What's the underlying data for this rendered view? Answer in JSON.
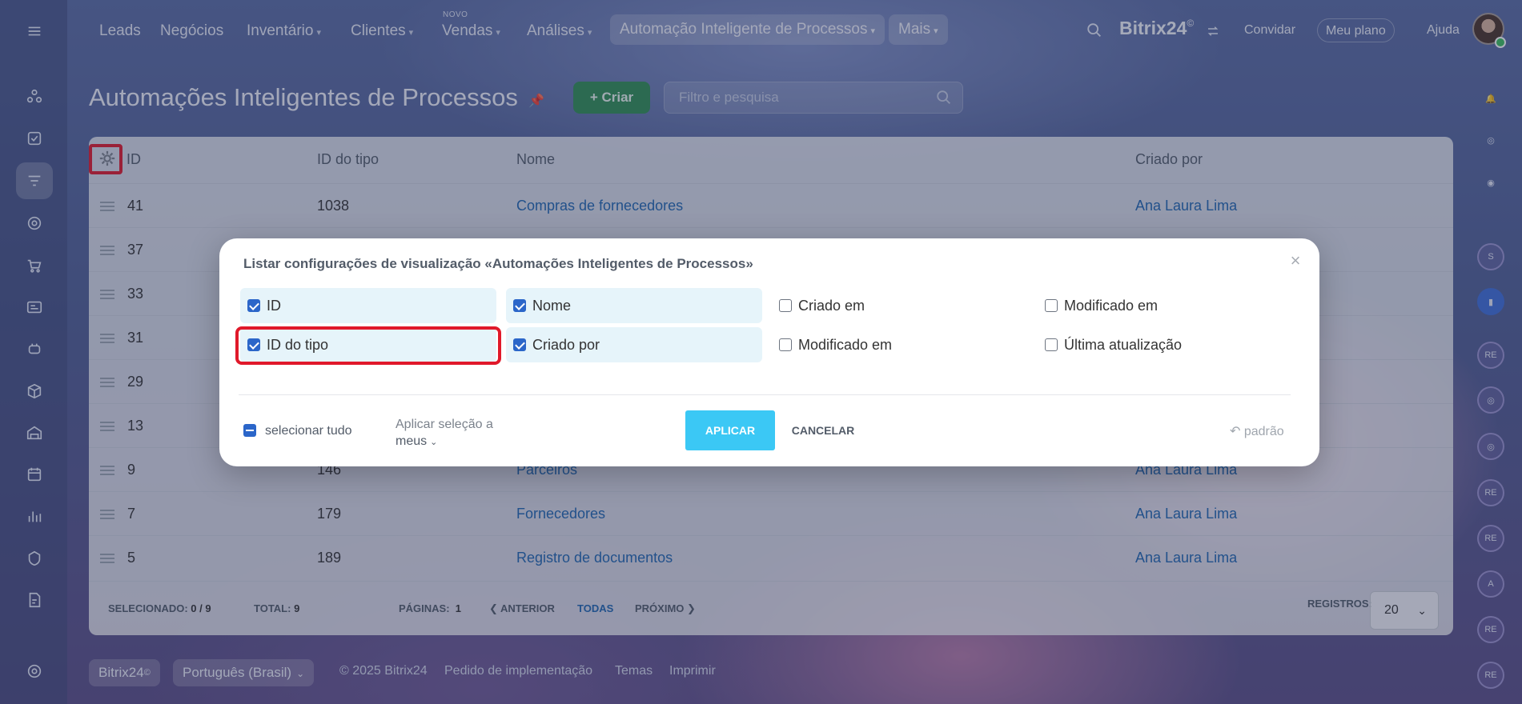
{
  "topnav": {
    "items": [
      {
        "label": "Leads",
        "dropdown": false
      },
      {
        "label": "Negócios",
        "dropdown": false
      },
      {
        "label": "Inventário",
        "dropdown": true
      },
      {
        "label": "Clientes",
        "dropdown": true
      },
      {
        "label": "Vendas",
        "dropdown": true,
        "badge": "NOVO"
      },
      {
        "label": "Análises",
        "dropdown": true
      }
    ],
    "active_item": "Automação Inteligente de Processos",
    "more": "Mais",
    "brand": "Bitrix24",
    "brand_mark": "©",
    "invite": "Convidar",
    "plan": "Meu plano",
    "help": "Ajuda"
  },
  "page": {
    "title": "Automações Inteligentes de Processos",
    "create_label": "Criar",
    "search_placeholder": "Filtro e pesquisa"
  },
  "table": {
    "columns": [
      "ID",
      "ID do tipo",
      "Nome",
      "Criado por"
    ],
    "rows": [
      {
        "id": "41",
        "type_id": "1038",
        "name": "Compras de fornecedores",
        "created_by": "Ana Laura Lima"
      },
      {
        "id": "37",
        "type_id": "",
        "name": "",
        "created_by": ""
      },
      {
        "id": "33",
        "type_id": "",
        "name": "",
        "created_by": ""
      },
      {
        "id": "31",
        "type_id": "",
        "name": "",
        "created_by": ""
      },
      {
        "id": "29",
        "type_id": "",
        "name": "",
        "created_by": ""
      },
      {
        "id": "13",
        "type_id": "",
        "name": "",
        "created_by": ""
      },
      {
        "id": "9",
        "type_id": "146",
        "name": "Parceiros",
        "created_by": "Ana Laura Lima"
      },
      {
        "id": "7",
        "type_id": "179",
        "name": "Fornecedores",
        "created_by": "Ana Laura Lima"
      },
      {
        "id": "5",
        "type_id": "189",
        "name": "Registro de documentos",
        "created_by": "Ana Laura Lima"
      }
    ],
    "footer": {
      "selected_label": "SELECIONADO:",
      "selected_value": "0 / 9",
      "total_label": "TOTAL:",
      "total_value": "9",
      "pages_label": "PÁGINAS:",
      "pages_value": "1",
      "prev": "ANTERIOR",
      "all": "TODAS",
      "next": "PRÓXIMO",
      "records_label": "REGISTROS:",
      "records_value": "20"
    }
  },
  "modal": {
    "title": "Listar configurações de visualização «Automações Inteligentes de Processos»",
    "options": [
      {
        "label": "ID",
        "checked": true
      },
      {
        "label": "Nome",
        "checked": true
      },
      {
        "label": "Criado em",
        "checked": false
      },
      {
        "label": "Modificado em",
        "checked": false
      },
      {
        "label": "ID do tipo",
        "checked": true
      },
      {
        "label": "Criado por",
        "checked": true
      },
      {
        "label": "Modificado em",
        "checked": false
      },
      {
        "label": "Última atualização",
        "checked": false
      }
    ],
    "select_all": "selecionar tudo",
    "apply_selection_line1": "Aplicar seleção a",
    "apply_selection_line2": "meus",
    "apply": "APLICAR",
    "cancel": "CANCELAR",
    "default": "padrão"
  },
  "footer": {
    "brand": "Bitrix24",
    "language": "Português (Brasil)",
    "copyright": "© 2025 Bitrix24",
    "implementation": "Pedido de implementação",
    "themes": "Temas",
    "print": "Imprimir"
  },
  "colors": {
    "accent_blue": "#3bc8f5",
    "create_green": "#2f8f53",
    "highlight_red": "#e0192a",
    "link_blue": "#2067b0"
  }
}
